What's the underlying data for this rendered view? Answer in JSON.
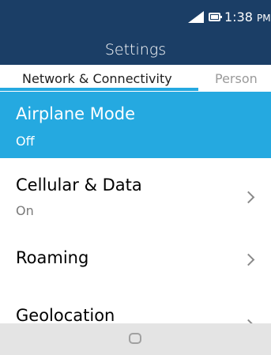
{
  "status_bar": {
    "time": "1:38",
    "ampm": "PM",
    "icons": [
      "signal-icon",
      "battery-icon"
    ]
  },
  "header": {
    "title": "Settings"
  },
  "tabs": [
    {
      "label": "Network & Connectivity",
      "active": true
    },
    {
      "label": "Person",
      "active": false
    }
  ],
  "settings": [
    {
      "title": "Airplane Mode",
      "value": "Off",
      "selected": true
    },
    {
      "title": "Cellular & Data",
      "value": "On",
      "selected": false
    },
    {
      "title": "Roaming",
      "selected": false
    },
    {
      "title": "Geolocation",
      "selected": false
    }
  ],
  "softkeys": {
    "center_icon": "home-icon"
  },
  "colors": {
    "header_bg": "#1b3e66",
    "accent": "#25a9e0",
    "softkey_bg": "#e4e4e4"
  }
}
